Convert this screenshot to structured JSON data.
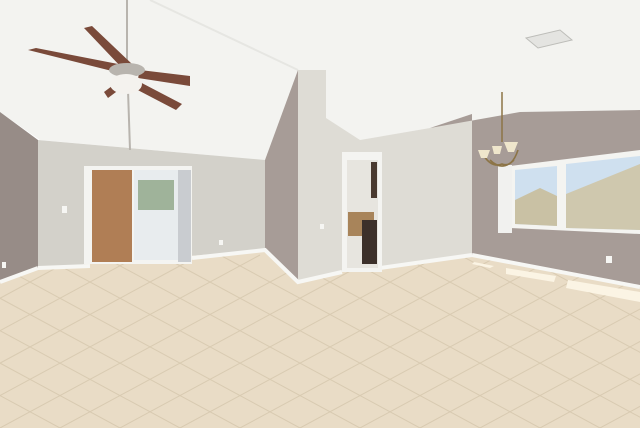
{
  "colors": {
    "ceiling": "#f3f3f0",
    "ceiling_shadow": "#e6e6e2",
    "wall_taupe": "#a79c97",
    "wall_taupe_dark": "#978c87",
    "wall_light": "#dedcd5",
    "wall_light_shade": "#d3d1ca",
    "floor": "#e9dcc6",
    "floor_far": "#efe4d1",
    "grout": "#d6c8ae",
    "baseboard": "#f7f7f4",
    "sunlight": "#fbf4e4",
    "fan_blade": "#7a4a3a",
    "fan_metal": "#b8b4ae",
    "chandelier_brass": "#8c7446",
    "window_sky": "#cfe0ef",
    "door_frame": "#f4f4f1"
  },
  "icons": {
    "fan": "ceiling-fan-icon",
    "light": "chandelier-icon",
    "vent": "air-vent-icon"
  }
}
